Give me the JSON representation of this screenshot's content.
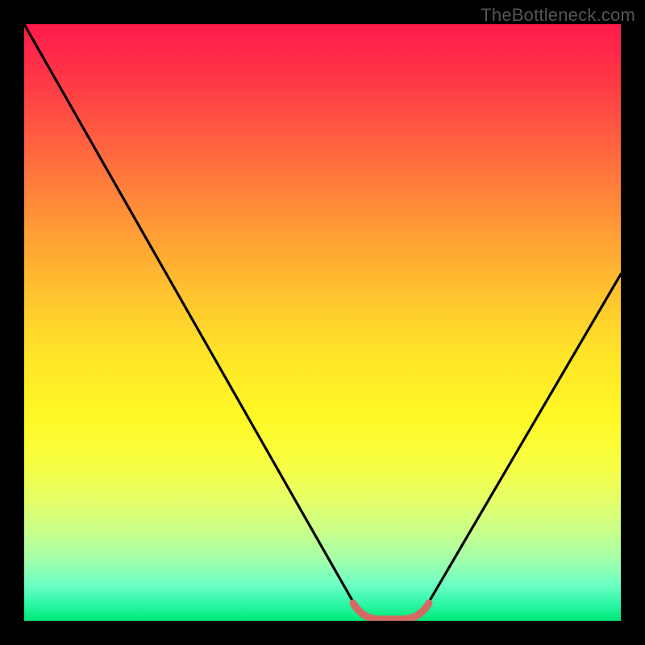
{
  "watermark": "TheBottleneck.com",
  "colors": {
    "black": "#000000",
    "curve": "#000000",
    "marker": "#d46a63"
  },
  "chart_data": {
    "type": "line",
    "title": "",
    "xlabel": "",
    "ylabel": "",
    "xlim": [
      0,
      100
    ],
    "ylim": [
      0,
      100
    ],
    "grid": false,
    "series": [
      {
        "name": "bottleneck-curve",
        "x": [
          0,
          5,
          10,
          15,
          20,
          25,
          30,
          35,
          40,
          45,
          50,
          55,
          58,
          62,
          65,
          70,
          75,
          80,
          85,
          90,
          95,
          100
        ],
        "y": [
          100,
          91,
          82,
          73,
          64,
          55,
          46,
          37,
          28,
          19,
          10,
          3,
          0,
          0,
          2,
          8,
          15,
          23,
          31,
          40,
          49,
          58
        ]
      }
    ],
    "annotations": [
      {
        "name": "optimal-zone-marker",
        "x_range": [
          55,
          65
        ],
        "y": 0,
        "color": "#d46a63"
      }
    ]
  }
}
